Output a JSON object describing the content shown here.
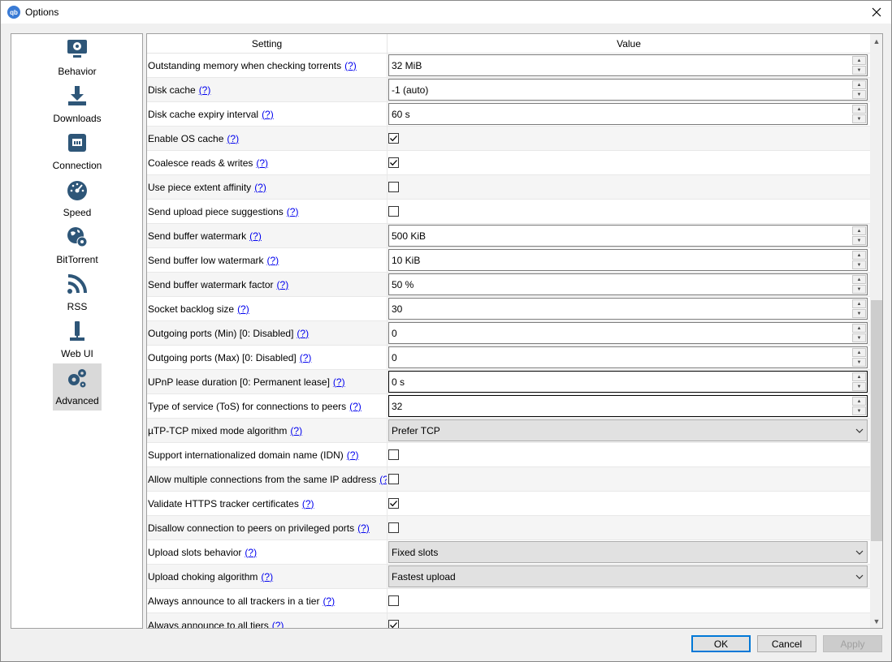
{
  "window": {
    "title": "Options",
    "app_icon_text": "qb"
  },
  "sidebar": {
    "items": [
      {
        "label": "Behavior",
        "icon": "gear-monitor-icon"
      },
      {
        "label": "Downloads",
        "icon": "download-icon"
      },
      {
        "label": "Connection",
        "icon": "network-icon"
      },
      {
        "label": "Speed",
        "icon": "speedometer-icon"
      },
      {
        "label": "BitTorrent",
        "icon": "globe-gear-icon"
      },
      {
        "label": "RSS",
        "icon": "rss-icon"
      },
      {
        "label": "Web UI",
        "icon": "webui-icon"
      },
      {
        "label": "Advanced",
        "icon": "gears-icon",
        "selected": true
      }
    ]
  },
  "table": {
    "header_setting": "Setting",
    "header_value": "Value",
    "help": "(?)",
    "rows": [
      {
        "setting": "Outstanding memory when checking torrents",
        "type": "spin",
        "value": "32 MiB"
      },
      {
        "setting": "Disk cache",
        "type": "spin",
        "value": "-1 (auto)"
      },
      {
        "setting": "Disk cache expiry interval",
        "type": "spin",
        "value": "60 s"
      },
      {
        "setting": "Enable OS cache",
        "type": "check",
        "checked": true
      },
      {
        "setting": "Coalesce reads & writes",
        "type": "check",
        "checked": true
      },
      {
        "setting": "Use piece extent affinity",
        "type": "check",
        "checked": false
      },
      {
        "setting": "Send upload piece suggestions",
        "type": "check",
        "checked": false
      },
      {
        "setting": "Send buffer watermark",
        "type": "spin",
        "value": "500 KiB"
      },
      {
        "setting": "Send buffer low watermark",
        "type": "spin",
        "value": "10 KiB"
      },
      {
        "setting": "Send buffer watermark factor",
        "type": "spin",
        "value": "50 %"
      },
      {
        "setting": "Socket backlog size",
        "type": "spin",
        "value": "30"
      },
      {
        "setting": "Outgoing ports (Min) [0: Disabled]",
        "type": "spin",
        "value": "0"
      },
      {
        "setting": "Outgoing ports (Max) [0: Disabled]",
        "type": "spin",
        "value": "0"
      },
      {
        "setting": "UPnP lease duration [0: Permanent lease]",
        "type": "spin",
        "value": "0 s"
      },
      {
        "setting": "Type of service (ToS) for connections to peers",
        "type": "spin",
        "value": "32"
      },
      {
        "setting": "µTP-TCP mixed mode algorithm",
        "type": "combo",
        "value": "Prefer TCP"
      },
      {
        "setting": "Support internationalized domain name (IDN)",
        "type": "check",
        "checked": false
      },
      {
        "setting": "Allow multiple connections from the same IP address",
        "type": "check",
        "checked": false
      },
      {
        "setting": "Validate HTTPS tracker certificates",
        "type": "check",
        "checked": true
      },
      {
        "setting": "Disallow connection to peers on privileged ports",
        "type": "check",
        "checked": false
      },
      {
        "setting": "Upload slots behavior",
        "type": "combo",
        "value": "Fixed slots"
      },
      {
        "setting": "Upload choking algorithm",
        "type": "combo",
        "value": "Fastest upload"
      },
      {
        "setting": "Always announce to all trackers in a tier",
        "type": "check",
        "checked": false
      },
      {
        "setting": "Always announce to all tiers",
        "type": "check",
        "checked": true
      }
    ]
  },
  "buttons": {
    "ok": "OK",
    "cancel": "Cancel",
    "apply": "Apply"
  }
}
